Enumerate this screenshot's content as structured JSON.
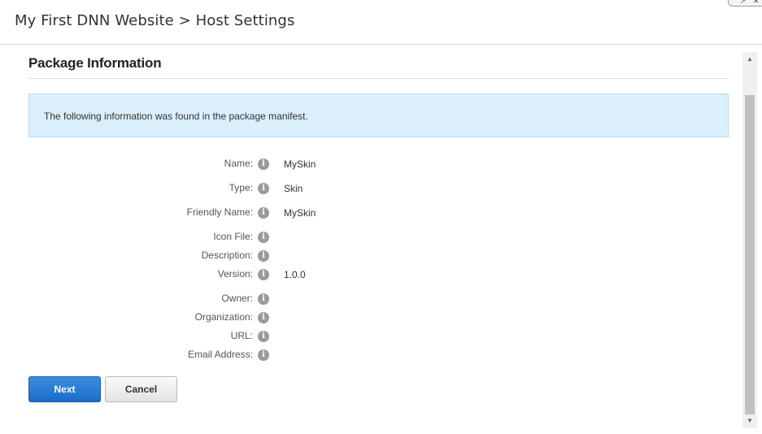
{
  "header": {
    "title": "My First DNN Website > Host Settings"
  },
  "section": {
    "heading": "Package Information",
    "info_message": "The following information was found in the package manifest."
  },
  "fields": [
    {
      "label": "Name:",
      "value": "MySkin"
    },
    {
      "label": "Type:",
      "value": "Skin"
    },
    {
      "label": "Friendly Name:",
      "value": "MySkin"
    },
    {
      "label": "Icon File:",
      "value": ""
    },
    {
      "label": "Description:",
      "value": ""
    },
    {
      "label": "Version:",
      "value": "1.0.0"
    },
    {
      "label": "Owner:",
      "value": ""
    },
    {
      "label": "Organization:",
      "value": ""
    },
    {
      "label": "URL:",
      "value": ""
    },
    {
      "label": "Email Address:",
      "value": ""
    }
  ],
  "info_icon_glyph": "i",
  "buttons": {
    "next_label": "Next",
    "cancel_label": "Cancel"
  },
  "colors": {
    "primary_button": "#1c6cc7",
    "info_box_bg": "#dbeefc",
    "info_box_border": "#b9dbf3"
  }
}
